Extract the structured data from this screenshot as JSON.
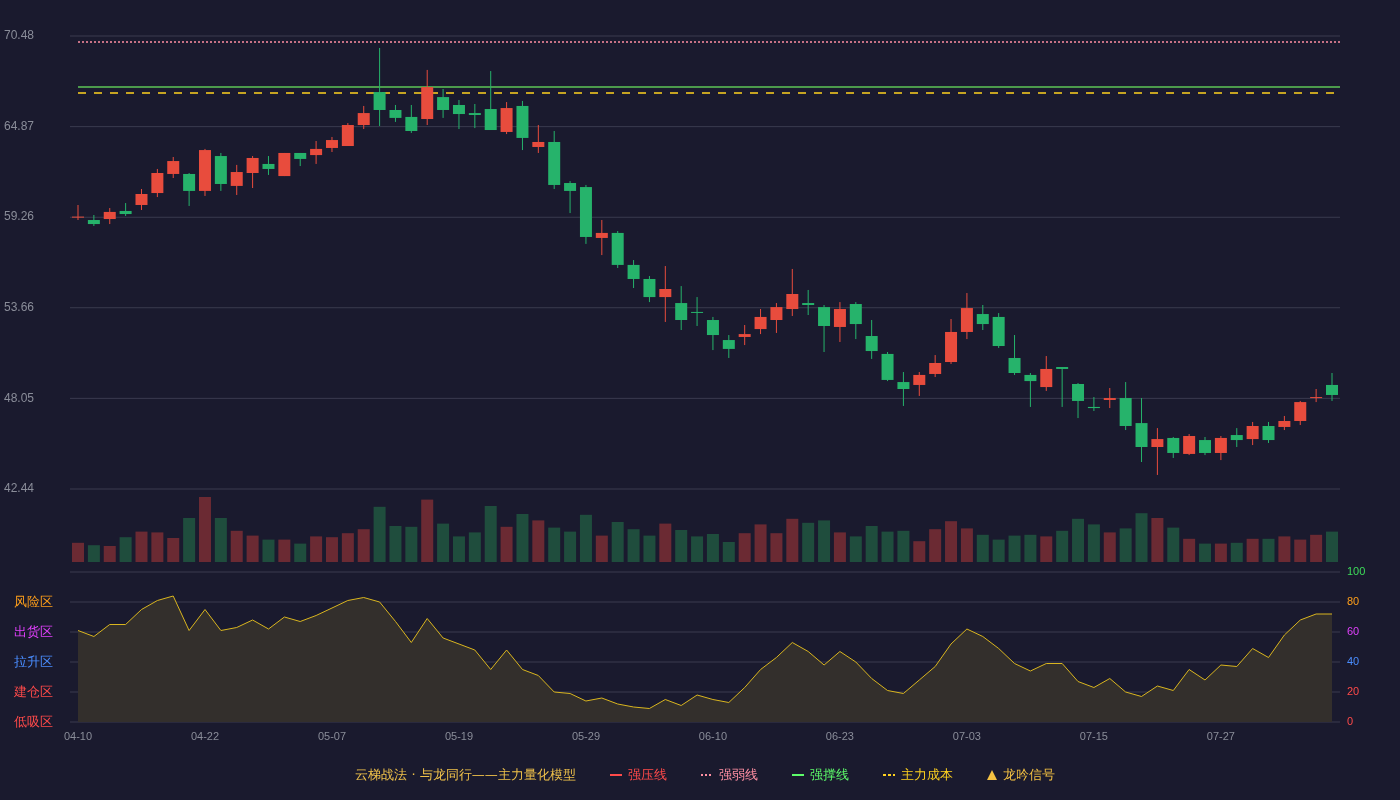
{
  "price_chart": {
    "chart_data": {
      "type": "candlestick",
      "grid": true,
      "ylim": [
        42.44,
        70.48
      ],
      "yticks": [
        70.48,
        64.87,
        59.26,
        53.66,
        48.05,
        42.44
      ],
      "categories": [
        null,
        null,
        null,
        null,
        null,
        null,
        null,
        null,
        null,
        null,
        null,
        null,
        null,
        null,
        null,
        null,
        null,
        null,
        null,
        null,
        null,
        null,
        null,
        null,
        null,
        null,
        null,
        null,
        null,
        null,
        null,
        null,
        null,
        null,
        null,
        null,
        null,
        null,
        null,
        null,
        null,
        null,
        null,
        null,
        null,
        null,
        null,
        null,
        null,
        null,
        null,
        null,
        null,
        null,
        null,
        null,
        null,
        null,
        null,
        null,
        null,
        null,
        null,
        null,
        null,
        null,
        null,
        null,
        null,
        null,
        null,
        null,
        null,
        null,
        null,
        null,
        null,
        null,
        null,
        null
      ],
      "ohlc": [
        [
          59.26,
          60.02,
          59.09,
          59.3
        ],
        [
          59.09,
          59.4,
          58.72,
          58.84
        ],
        [
          59.15,
          59.83,
          58.84,
          59.59
        ],
        [
          59.65,
          60.14,
          59.34,
          59.46
        ],
        [
          60.02,
          61.01,
          59.71,
          60.7
        ],
        [
          60.76,
          62.25,
          60.51,
          62.0
        ],
        [
          61.94,
          62.99,
          61.69,
          62.74
        ],
        [
          61.94,
          62.0,
          59.96,
          60.89
        ],
        [
          60.89,
          63.49,
          60.58,
          63.42
        ],
        [
          63.05,
          63.24,
          60.89,
          61.32
        ],
        [
          61.2,
          62.5,
          60.64,
          62.06
        ],
        [
          62.0,
          63.05,
          61.07,
          62.93
        ],
        [
          62.56,
          63.05,
          61.88,
          62.25
        ],
        [
          61.81,
          63.24,
          61.81,
          63.24
        ],
        [
          63.24,
          63.24,
          62.43,
          62.87
        ],
        [
          63.11,
          63.98,
          62.56,
          63.49
        ],
        [
          63.55,
          64.23,
          63.3,
          64.04
        ],
        [
          63.67,
          65.09,
          63.67,
          64.97
        ],
        [
          64.97,
          66.15,
          64.72,
          65.71
        ],
        [
          67.01,
          69.74,
          64.91,
          65.9
        ],
        [
          65.9,
          66.21,
          65.16,
          65.41
        ],
        [
          65.47,
          66.21,
          64.48,
          64.6
        ],
        [
          65.34,
          68.38,
          64.97,
          67.32
        ],
        [
          66.7,
          67.2,
          65.41,
          65.9
        ],
        [
          66.21,
          66.52,
          64.72,
          65.65
        ],
        [
          65.71,
          66.27,
          64.78,
          65.59
        ],
        [
          65.96,
          68.31,
          64.66,
          64.66
        ],
        [
          64.54,
          66.39,
          64.41,
          66.02
        ],
        [
          66.15,
          66.46,
          63.42,
          64.17
        ],
        [
          63.61,
          64.97,
          63.24,
          63.92
        ],
        [
          63.92,
          64.6,
          61.01,
          61.26
        ],
        [
          61.38,
          61.5,
          59.52,
          60.89
        ],
        [
          61.13,
          61.26,
          57.61,
          58.04
        ],
        [
          57.98,
          59.09,
          56.92,
          58.29
        ],
        [
          58.29,
          58.41,
          56.12,
          56.31
        ],
        [
          56.31,
          56.61,
          54.88,
          55.44
        ],
        [
          55.44,
          55.62,
          54.01,
          54.32
        ],
        [
          54.32,
          56.24,
          52.78,
          54.82
        ],
        [
          53.95,
          55.0,
          52.28,
          52.9
        ],
        [
          53.4,
          54.32,
          52.53,
          53.37
        ],
        [
          52.9,
          53.09,
          51.04,
          51.97
        ],
        [
          51.66,
          51.97,
          50.55,
          51.11
        ],
        [
          51.85,
          52.59,
          51.35,
          52.03
        ],
        [
          52.34,
          53.58,
          52.03,
          53.09
        ],
        [
          52.9,
          53.95,
          52.1,
          53.7
        ],
        [
          53.58,
          56.06,
          53.15,
          54.51
        ],
        [
          53.95,
          54.76,
          53.21,
          53.83
        ],
        [
          53.7,
          53.83,
          50.92,
          52.53
        ],
        [
          52.47,
          54.01,
          51.54,
          53.58
        ],
        [
          53.89,
          54.01,
          51.72,
          52.65
        ],
        [
          51.91,
          52.9,
          50.49,
          50.98
        ],
        [
          50.8,
          50.92,
          49.12,
          49.19
        ],
        [
          49.06,
          49.68,
          47.58,
          48.63
        ],
        [
          48.88,
          49.68,
          48.2,
          49.5
        ],
        [
          49.56,
          50.73,
          49.37,
          50.24
        ],
        [
          50.3,
          52.96,
          50.18,
          52.16
        ],
        [
          52.16,
          54.57,
          51.72,
          53.64
        ],
        [
          53.27,
          53.83,
          52.28,
          52.65
        ],
        [
          53.09,
          53.33,
          51.17,
          51.29
        ],
        [
          50.55,
          51.97,
          49.5,
          49.62
        ],
        [
          49.5,
          49.62,
          47.52,
          49.12
        ],
        [
          48.75,
          50.67,
          48.51,
          49.87
        ],
        [
          49.99,
          49.99,
          47.52,
          49.87
        ],
        [
          48.94,
          49.0,
          46.83,
          47.89
        ],
        [
          47.52,
          48.13,
          47.27,
          47.45
        ],
        [
          47.95,
          48.69,
          47.45,
          48.07
        ],
        [
          48.07,
          49.06,
          46.09,
          46.34
        ],
        [
          46.52,
          48.07,
          44.11,
          45.04
        ],
        [
          45.04,
          46.21,
          43.31,
          45.53
        ],
        [
          45.6,
          45.66,
          44.36,
          44.67
        ],
        [
          44.61,
          45.84,
          44.54,
          45.72
        ],
        [
          45.47,
          45.66,
          44.54,
          44.67
        ],
        [
          44.67,
          45.72,
          44.23,
          45.6
        ],
        [
          45.78,
          46.21,
          45.04,
          45.47
        ],
        [
          45.53,
          46.59,
          45.16,
          46.34
        ],
        [
          46.34,
          46.59,
          45.29,
          45.47
        ],
        [
          46.28,
          46.96,
          46.09,
          46.65
        ],
        [
          46.65,
          47.89,
          46.4,
          47.82
        ],
        [
          48.07,
          48.63,
          47.82,
          48.13
        ],
        [
          48.88,
          49.62,
          47.89,
          48.26
        ]
      ],
      "ref_lines": [
        {
          "axis": "y",
          "value": 70.11,
          "color": "#ff8fa3"
        },
        {
          "axis": "y",
          "value": 67.32,
          "color": "#4c9a4c"
        },
        {
          "axis": "y",
          "value": 66.95,
          "color": "#ffd21f"
        }
      ]
    }
  },
  "oscillator": {
    "chart_data": {
      "type": "area",
      "grid": true,
      "ylim": [
        0,
        100
      ],
      "categories": [
        "04-10",
        null,
        null,
        null,
        null,
        null,
        null,
        null,
        "04-22",
        null,
        null,
        null,
        null,
        null,
        null,
        null,
        "05-07",
        null,
        null,
        null,
        null,
        null,
        null,
        null,
        "05-19",
        null,
        null,
        null,
        null,
        null,
        null,
        null,
        "05-29",
        null,
        null,
        null,
        null,
        null,
        null,
        null,
        "06-10",
        null,
        null,
        null,
        null,
        null,
        null,
        null,
        "06-23",
        null,
        null,
        null,
        null,
        null,
        null,
        null,
        "07-03",
        null,
        null,
        null,
        null,
        null,
        null,
        null,
        "07-15",
        null,
        null,
        null,
        null,
        null,
        null,
        null,
        "07-27",
        null,
        null,
        null,
        null,
        null,
        null,
        null
      ],
      "yticks": [
        {
          "value": 100,
          "label": "100"
        },
        {
          "value": 80,
          "label": "80"
        },
        {
          "value": 60,
          "label": "60"
        },
        {
          "value": 40,
          "label": "40"
        },
        {
          "value": 20,
          "label": "20"
        },
        {
          "value": 0,
          "label": "0"
        }
      ],
      "series": [
        {
          "color": "#d9b51f",
          "values": [
            61,
            57,
            65,
            65,
            75,
            81,
            84,
            61,
            75,
            61,
            63,
            68,
            62,
            70,
            67,
            71,
            76,
            81,
            83,
            80,
            67,
            53,
            69,
            56,
            52,
            48,
            35,
            48,
            35,
            31,
            20,
            19,
            14,
            16,
            12,
            10,
            9,
            15,
            11,
            18,
            15,
            13,
            23,
            35,
            43,
            53,
            47,
            38,
            47,
            40,
            29,
            21,
            19,
            28,
            37,
            52,
            62,
            57,
            49,
            39,
            34,
            39,
            39,
            27,
            23,
            29,
            20,
            17,
            24,
            21,
            35,
            28,
            38,
            37,
            49,
            43,
            58,
            68,
            72,
            72
          ]
        }
      ]
    },
    "zones": [
      {
        "label": "风险区"
      },
      {
        "label": "出货区"
      },
      {
        "label": "拉升区"
      },
      {
        "label": "建仓区"
      },
      {
        "label": "低吸区"
      }
    ]
  },
  "legend": {
    "title": "云梯战法 · 与龙同行——主力量化模型",
    "items": [
      {
        "label": "强压线",
        "kind": "solid",
        "color": "#ff4a4a"
      },
      {
        "label": "强弱线",
        "kind": "dotted",
        "color": "#ff8fa3"
      },
      {
        "label": "强撑线",
        "kind": "solid",
        "color": "#5dfc6a"
      },
      {
        "label": "主力成本",
        "kind": "dashed",
        "color": "#ffd21f"
      },
      {
        "label": "龙吟信号",
        "kind": "triangle",
        "color": "#f5c242"
      }
    ]
  }
}
